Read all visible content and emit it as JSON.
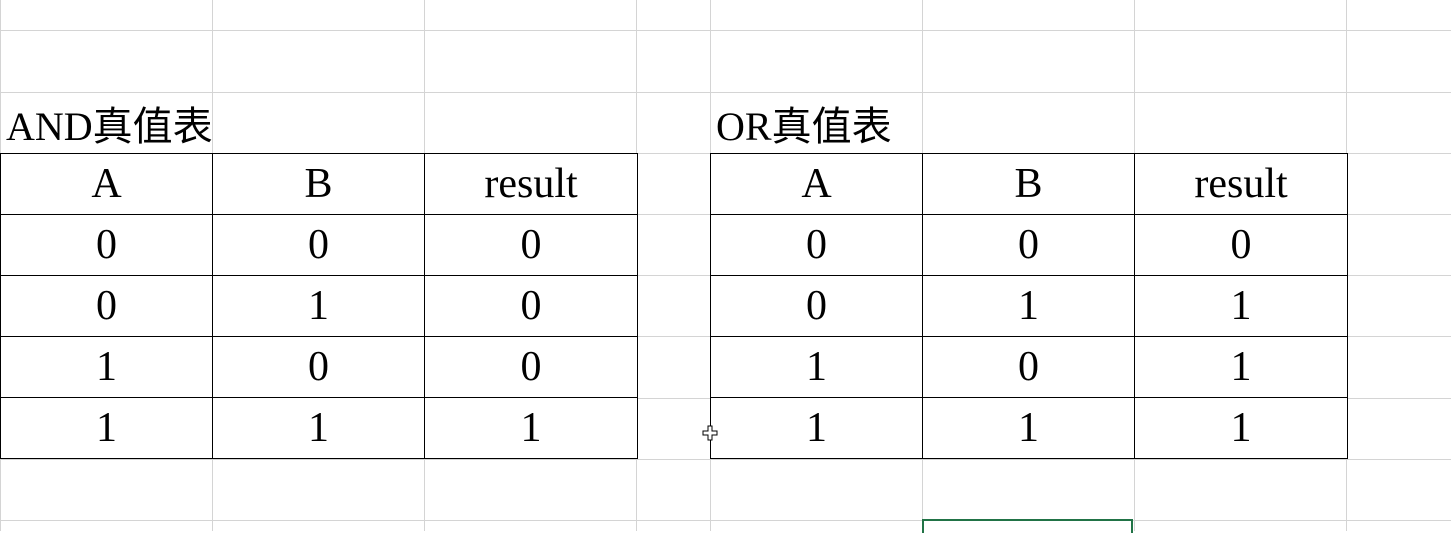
{
  "sheet": {
    "colors": {
      "gridline": "#d4d4d4",
      "border": "#000000",
      "selection": "#217346"
    }
  },
  "and_table": {
    "title": "AND真值表",
    "headers": [
      "A",
      "B",
      "result"
    ],
    "rows": [
      [
        "0",
        "0",
        "0"
      ],
      [
        "0",
        "1",
        "0"
      ],
      [
        "1",
        "0",
        "0"
      ],
      [
        "1",
        "1",
        "1"
      ]
    ]
  },
  "or_table": {
    "title": "OR真值表",
    "headers": [
      "A",
      "B",
      "result"
    ],
    "rows": [
      [
        "0",
        "0",
        "0"
      ],
      [
        "0",
        "1",
        "1"
      ],
      [
        "1",
        "0",
        "1"
      ],
      [
        "1",
        "1",
        "1"
      ]
    ]
  },
  "cursor": {
    "icon": "cross-cursor-icon"
  }
}
